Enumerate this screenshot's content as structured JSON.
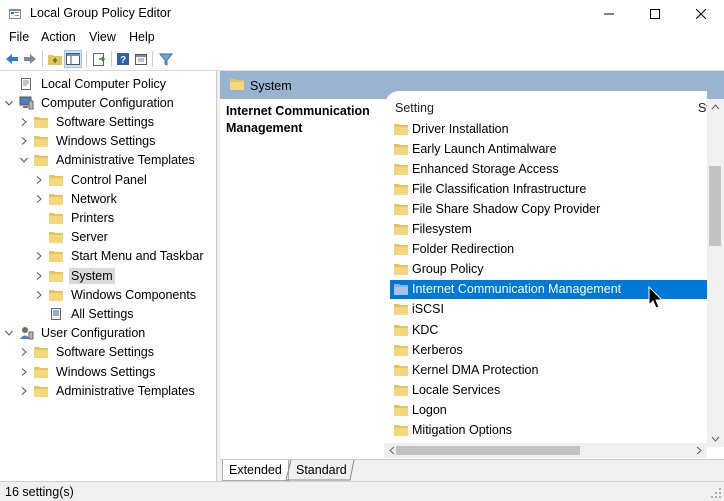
{
  "window": {
    "title": "Local Group Policy Editor",
    "controls": [
      "minimize",
      "maximize",
      "close"
    ]
  },
  "menu": [
    {
      "label": "File"
    },
    {
      "label": "Action"
    },
    {
      "label": "View"
    },
    {
      "label": "Help"
    }
  ],
  "toolbar": {
    "buttons": [
      "back-icon",
      "forward-icon",
      "up-folder-icon",
      "show-hide-tree-icon",
      "export-list-icon",
      "help-icon",
      "properties-icon",
      "filter-icon"
    ]
  },
  "tree": {
    "items": [
      {
        "label": "Local Computer Policy",
        "icon": "policy-icon",
        "expander": "none"
      },
      {
        "label": "Computer Configuration",
        "icon": "computer-icon",
        "expander": "expanded"
      },
      {
        "label": "Software Settings",
        "icon": "folder-icon",
        "expander": "collapsed"
      },
      {
        "label": "Windows Settings",
        "icon": "folder-icon",
        "expander": "collapsed"
      },
      {
        "label": "Administrative Templates",
        "icon": "folder-icon",
        "expander": "expanded"
      },
      {
        "label": "Control Panel",
        "icon": "folder-icon",
        "expander": "collapsed"
      },
      {
        "label": "Network",
        "icon": "folder-icon",
        "expander": "collapsed"
      },
      {
        "label": "Printers",
        "icon": "folder-icon",
        "expander": "none"
      },
      {
        "label": "Server",
        "icon": "folder-icon",
        "expander": "none"
      },
      {
        "label": "Start Menu and Taskbar",
        "icon": "folder-icon",
        "expander": "collapsed"
      },
      {
        "label": "System",
        "icon": "folder-icon",
        "expander": "collapsed",
        "selected": true
      },
      {
        "label": "Windows Components",
        "icon": "folder-icon",
        "expander": "collapsed"
      },
      {
        "label": "All Settings",
        "icon": "settings-icon",
        "expander": "none"
      },
      {
        "label": "User Configuration",
        "icon": "user-icon",
        "expander": "expanded"
      },
      {
        "label": "Software Settings",
        "icon": "folder-icon",
        "expander": "collapsed"
      },
      {
        "label": "Windows Settings",
        "icon": "folder-icon",
        "expander": "collapsed"
      },
      {
        "label": "Administrative Templates",
        "icon": "folder-icon",
        "expander": "collapsed"
      }
    ]
  },
  "path_bar": {
    "label": "System"
  },
  "extended_pane": {
    "title": "Internet Communication Management"
  },
  "list": {
    "columns": [
      "Setting",
      "St"
    ],
    "rows": [
      {
        "label": "Driver Installation"
      },
      {
        "label": "Early Launch Antimalware"
      },
      {
        "label": "Enhanced Storage Access"
      },
      {
        "label": "File Classification Infrastructure"
      },
      {
        "label": "File Share Shadow Copy Provider"
      },
      {
        "label": "Filesystem"
      },
      {
        "label": "Folder Redirection"
      },
      {
        "label": "Group Policy"
      },
      {
        "label": "Internet Communication Management",
        "selected": true
      },
      {
        "label": "iSCSI"
      },
      {
        "label": "KDC"
      },
      {
        "label": "Kerberos"
      },
      {
        "label": "Kernel DMA Protection"
      },
      {
        "label": "Locale Services"
      },
      {
        "label": "Logon"
      },
      {
        "label": "Mitigation Options"
      }
    ]
  },
  "tabs": [
    {
      "label": "Extended",
      "active": true
    },
    {
      "label": "Standard",
      "active": false
    }
  ],
  "status": {
    "text": "16 setting(s)"
  },
  "colors": {
    "path_bar": "#99b4d1",
    "selection": "#0078d7",
    "folder": "#e8c25a"
  }
}
